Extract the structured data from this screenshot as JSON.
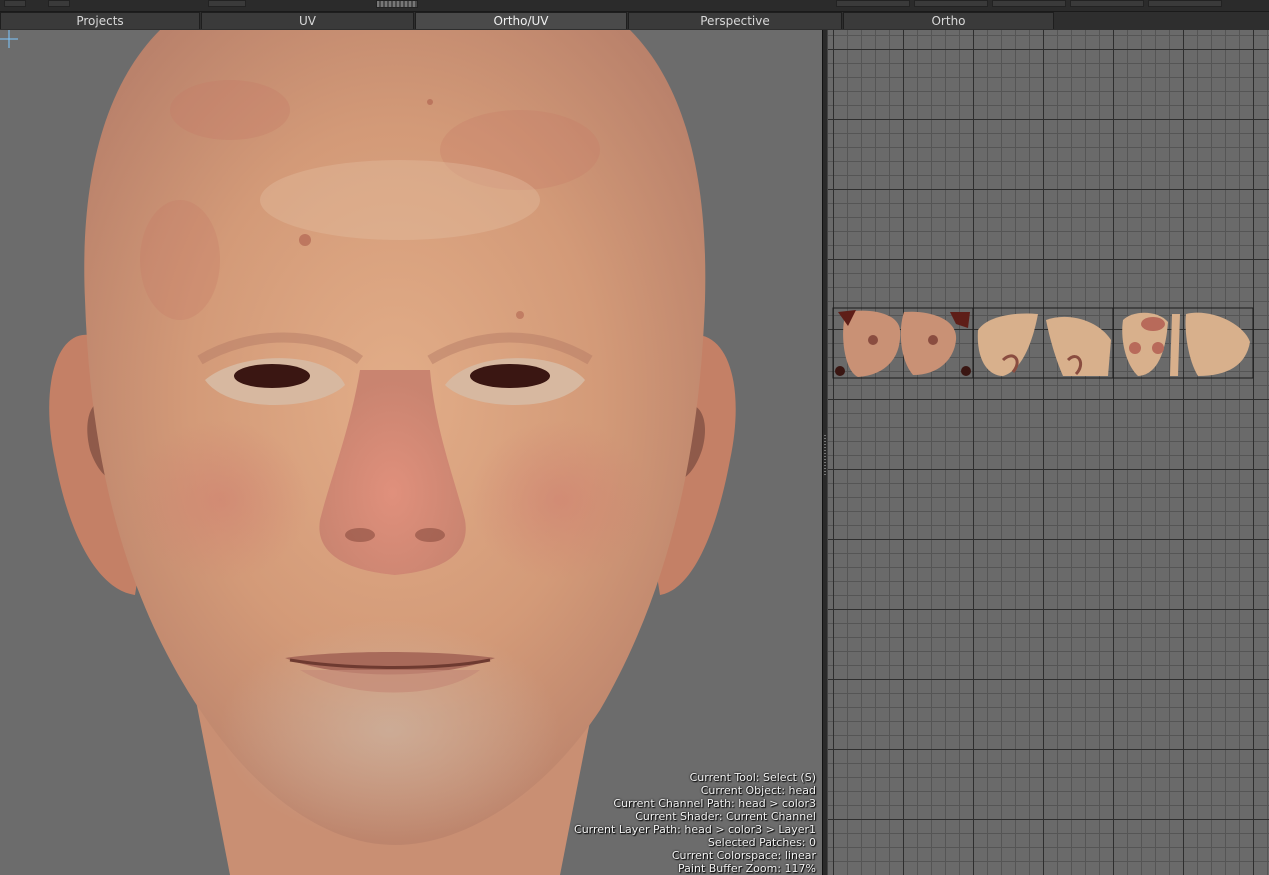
{
  "tabs": [
    {
      "label": "Projects",
      "active": false
    },
    {
      "label": "UV",
      "active": false
    },
    {
      "label": "Ortho/UV",
      "active": true
    },
    {
      "label": "Perspective",
      "active": false
    },
    {
      "label": "Ortho",
      "active": false
    }
  ],
  "viewport": {
    "object_icon": "head-mesh-render",
    "cursor_icon": "crosshair-icon",
    "status": {
      "current_tool": "Current Tool: Select (S)",
      "current_object": "Current Object: head",
      "channel_path": "Current Channel Path: head > color3",
      "shader": "Current Shader: Current Channel",
      "layer_path": "Current Layer Path: head > color3 > Layer1",
      "selected_patches": "Selected Patches: 0",
      "colorspace": "Current Colorspace: linear",
      "paint_buffer_zoom": "Paint Buffer Zoom: 117%"
    }
  },
  "uv_view": {
    "grid": true,
    "shells_icon": "uv-texture-shells"
  },
  "colors": {
    "viewport_bg": "#6c6c6c",
    "skin_base": "#d9a37e",
    "tab_bg": "#3a3a3a",
    "tab_text": "#d8d8d8"
  }
}
